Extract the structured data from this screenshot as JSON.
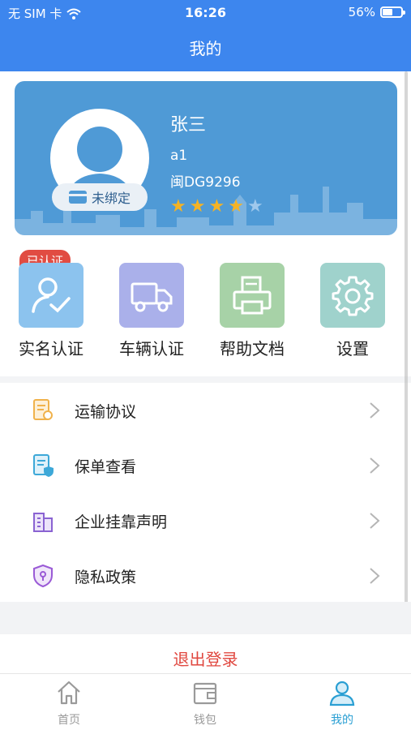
{
  "status_bar": {
    "carrier": "无 SIM 卡",
    "time": "16:26",
    "battery_text": "56%",
    "battery_level": 0.56
  },
  "header": {
    "title": "我的"
  },
  "profile": {
    "name": "张三",
    "id": "a1",
    "plate": "闽DG9296",
    "bind_status": "未绑定",
    "rating": 4,
    "rating_max": 5
  },
  "actions": [
    {
      "label": "实名认证",
      "badge": "已认证",
      "icon": "id-verify-icon",
      "color": "#8cc3ee"
    },
    {
      "label": "车辆认证",
      "icon": "truck-icon",
      "color": "#aab0ea"
    },
    {
      "label": "帮助文档",
      "icon": "printer-icon",
      "color": "#a7d2a7"
    },
    {
      "label": "设置",
      "icon": "gear-icon",
      "color": "#9fd2cc"
    }
  ],
  "menu": [
    {
      "label": "运输协议",
      "icon": "agreement-icon",
      "color": "#f0b24b"
    },
    {
      "label": "保单查看",
      "icon": "policy-icon",
      "color": "#3da8d8"
    },
    {
      "label": "企业挂靠声明",
      "icon": "building-icon",
      "color": "#8a63d2"
    },
    {
      "label": "隐私政策",
      "icon": "privacy-shield-icon",
      "color": "#9a5ad6"
    }
  ],
  "logout": {
    "label": "退出登录"
  },
  "tabs": [
    {
      "label": "首页",
      "icon": "home-icon"
    },
    {
      "label": "钱包",
      "icon": "wallet-icon"
    },
    {
      "label": "我的",
      "icon": "user-icon",
      "active": true
    }
  ],
  "colors": {
    "brand": "#3d86ee",
    "card": "#4f9ad6",
    "danger": "#e0473f",
    "tab_active": "#2a9fd3"
  }
}
